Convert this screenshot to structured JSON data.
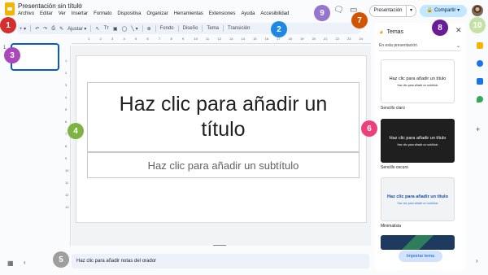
{
  "header": {
    "doc_title": "Presentación sin título",
    "menu": [
      "Archivo",
      "Editar",
      "Ver",
      "Insertar",
      "Formato",
      "Dispositiva",
      "Organizar",
      "Herramientas",
      "Extensiones",
      "Ayuda",
      "Accesibilidad"
    ],
    "present_label": "Presentación",
    "present_drop": "▾",
    "share_label": "Compartir"
  },
  "toolbar": {
    "add": "+ ▾",
    "undo": "↶",
    "redo": "↷",
    "print": "⎙",
    "paint": "✎",
    "zoom": "Ajustar ▾",
    "select": "↖",
    "textbox": "Tт",
    "image": "▣",
    "shape": "◯",
    "line": "╲ ▾",
    "comment": "⊕",
    "background": "Fondo",
    "layout": "Diseño",
    "theme": "Tema",
    "transition": "Transición"
  },
  "filmstrip": {
    "slide_number": "1"
  },
  "ruler_h": [
    "1",
    "2",
    "3",
    "4",
    "5",
    "6",
    "7",
    "8",
    "9",
    "10",
    "11",
    "12",
    "13",
    "14",
    "15",
    "16",
    "17",
    "18",
    "19",
    "20",
    "21",
    "22",
    "23",
    "24"
  ],
  "ruler_v": [
    "1",
    "2",
    "3",
    "4",
    "5",
    "6",
    "7",
    "8",
    "9",
    "10",
    "11",
    "12",
    "13"
  ],
  "slide": {
    "title_placeholder": "Haz clic para añadir un título",
    "subtitle_placeholder": "Haz clic para añadir un subtítulo"
  },
  "notes": {
    "placeholder": "Haz clic para añadir notas del orador"
  },
  "themes": {
    "heading": "Temas",
    "scope": "En esta presentación",
    "items": [
      {
        "name": "Sencillo claro",
        "title": "Haz clic para añadir un título",
        "sub": "Haz clic para añadir un subtítulo"
      },
      {
        "name": "Sencillo oscuro",
        "title": "Haz clic para añadir un título",
        "sub": "Haz clic para añadir un subtítulo"
      },
      {
        "name": "Minimalista",
        "title": "Haz clic para añadir un título",
        "sub": "Haz clic para añadir un subtítulo"
      }
    ],
    "import_label": "Importar tema"
  },
  "markers": [
    {
      "label": "1",
      "color": "#d32f2f"
    },
    {
      "label": "2",
      "color": "#1e88e5"
    },
    {
      "label": "3",
      "color": "#ab47bc"
    },
    {
      "label": "4",
      "color": "#7cb342"
    },
    {
      "label": "5",
      "color": "#9e9e9e"
    },
    {
      "label": "6",
      "color": "#ec407a"
    },
    {
      "label": "7",
      "color": "#d35400"
    },
    {
      "label": "8",
      "color": "#6a1b9a"
    },
    {
      "label": "9",
      "color": "#9575cd"
    },
    {
      "label": "10",
      "color": "#c5e1a5"
    }
  ]
}
